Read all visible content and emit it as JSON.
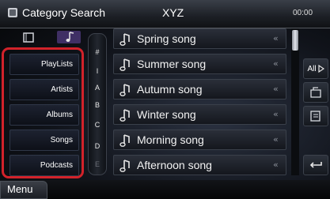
{
  "header": {
    "title": "Category Search",
    "center_label": "XYZ",
    "time": "00:00",
    "icon": "search-icon"
  },
  "top_icons": [
    "folder-icon",
    "music-note-icon"
  ],
  "categories": [
    {
      "label": "PlayLists"
    },
    {
      "label": "Artists"
    },
    {
      "label": "Albums"
    },
    {
      "label": "Songs"
    },
    {
      "label": "Podcasts"
    }
  ],
  "alphabet_index": [
    "#",
    "I",
    "A",
    "B",
    "C",
    "D",
    "E"
  ],
  "songs": [
    {
      "title": "Spring song"
    },
    {
      "title": "Summer song"
    },
    {
      "title": "Autumn song"
    },
    {
      "title": "Winter song"
    },
    {
      "title": "Morning song"
    },
    {
      "title": "Afternoon song"
    }
  ],
  "side_buttons": {
    "all_label": "All",
    "second_icon": "folder-up-icon",
    "third_icon": "list-jump-icon",
    "back_icon": "return-icon"
  },
  "footer": {
    "menu_label": "Menu"
  },
  "colors": {
    "highlight": "#d2222a"
  }
}
